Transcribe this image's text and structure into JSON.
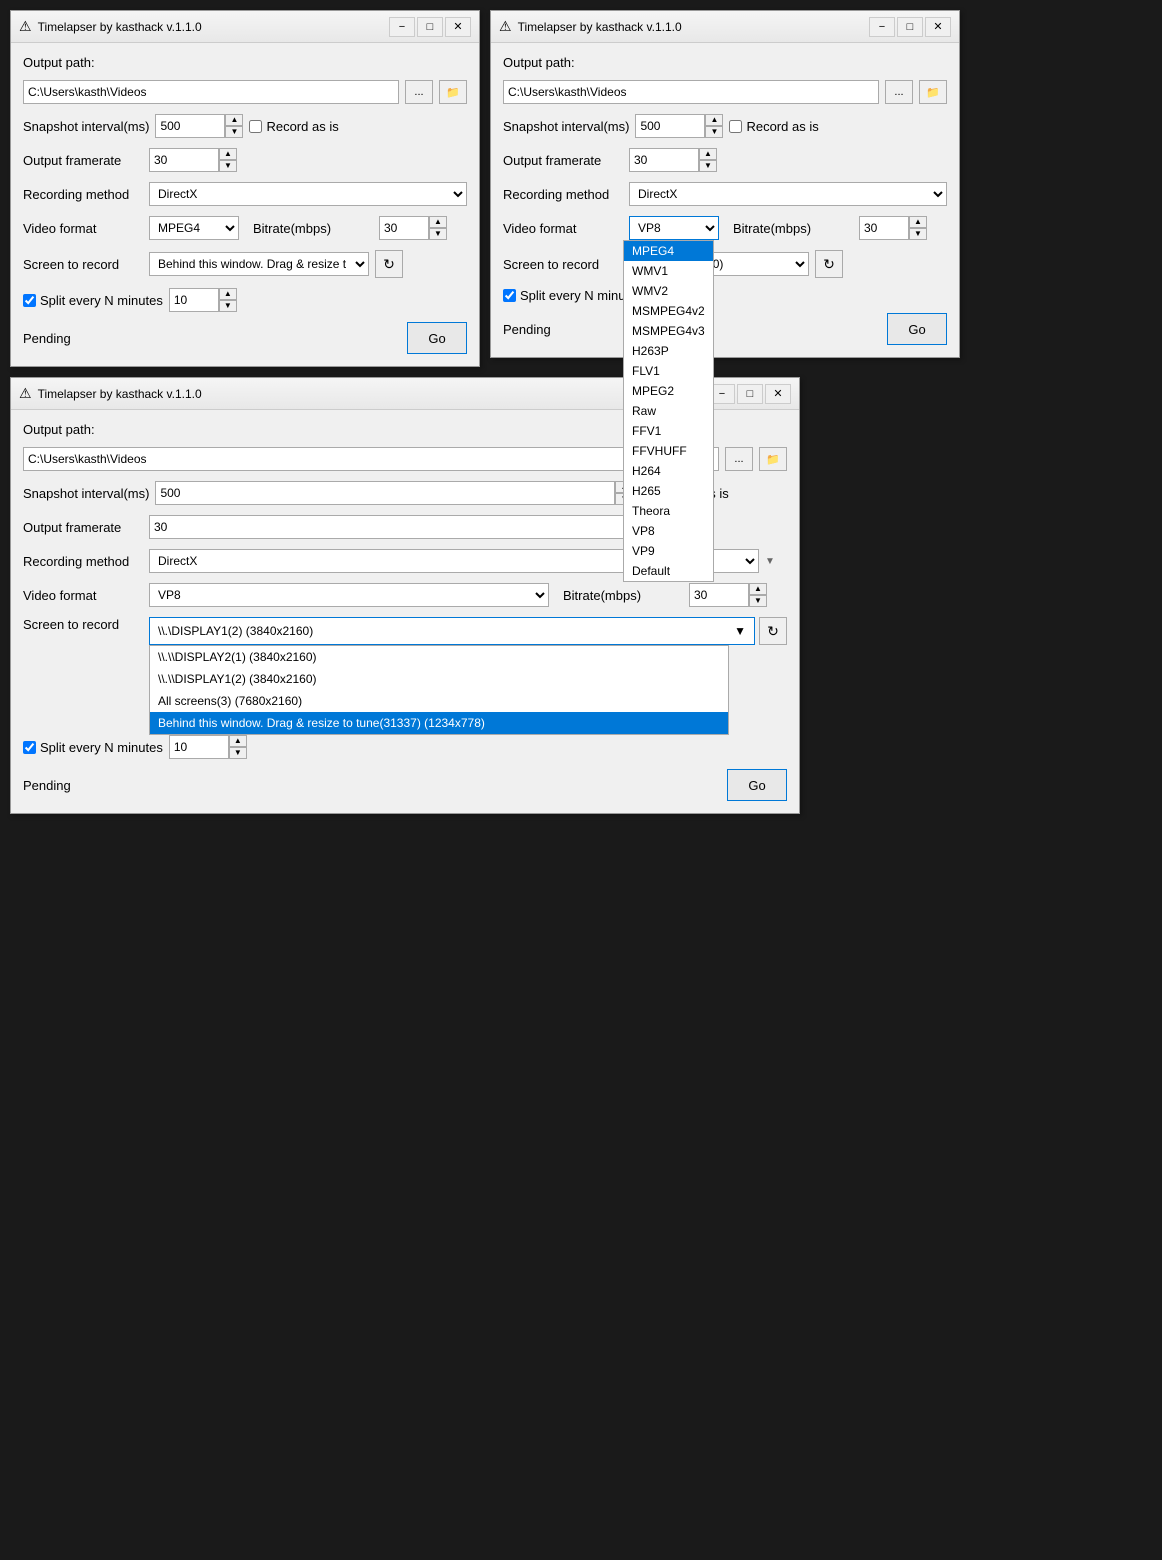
{
  "window1": {
    "title": "Timelapser by kasthack v.1.1.0",
    "output_path_label": "Output path:",
    "output_path_value": "C:\\Users\\kasth\\Videos",
    "snapshot_interval_label": "Snapshot interval(ms)",
    "snapshot_interval_value": "500",
    "record_as_is_label": "Record as is",
    "output_framerate_label": "Output framerate",
    "output_framerate_value": "30",
    "recording_method_label": "Recording method",
    "recording_method_value": "DirectX",
    "video_format_label": "Video format",
    "video_format_value": "MPEG4",
    "bitrate_label": "Bitrate(mbps)",
    "bitrate_value": "30",
    "screen_to_record_label": "Screen to record",
    "screen_to_record_value": "Behind this window. Drag & resize t",
    "split_label": "Split every N minutes",
    "split_value": "10",
    "status_label": "Pending",
    "go_btn_label": "Go",
    "browse_dots": "...",
    "browse_folder": "📁"
  },
  "window2": {
    "title": "Timelapser by kasthack v.1.1.0",
    "output_path_label": "Output path:",
    "output_path_value": "C:\\Users\\kasth\\Videos",
    "snapshot_interval_label": "Snapshot interval(ms)",
    "snapshot_interval_value": "500",
    "record_as_is_label": "Record as is",
    "output_framerate_label": "Output framerate",
    "output_framerate_value": "30",
    "recording_method_label": "Recording method",
    "recording_method_value": "DirectX",
    "video_format_label": "Video format",
    "video_format_value": "VP8",
    "bitrate_label": "Bitrate(mbps)",
    "bitrate_value": "30",
    "screen_to_record_label": "Screen to record",
    "screen_to_record_value": "(2) (3840x2160)",
    "split_label": "Split every N minutes",
    "status_label": "Pending",
    "go_btn_label": "Go",
    "browse_dots": "...",
    "browse_folder": "📁",
    "dropdown_items": [
      {
        "label": "MPEG4",
        "selected": true
      },
      {
        "label": "WMV1",
        "selected": false
      },
      {
        "label": "WMV2",
        "selected": false
      },
      {
        "label": "MSMPEG4v2",
        "selected": false
      },
      {
        "label": "MSMPEG4v3",
        "selected": false
      },
      {
        "label": "H263P",
        "selected": false
      },
      {
        "label": "FLV1",
        "selected": false
      },
      {
        "label": "MPEG2",
        "selected": false
      },
      {
        "label": "Raw",
        "selected": false
      },
      {
        "label": "FFV1",
        "selected": false
      },
      {
        "label": "FFVHUFF",
        "selected": false
      },
      {
        "label": "H264",
        "selected": false
      },
      {
        "label": "H265",
        "selected": false
      },
      {
        "label": "Theora",
        "selected": false
      },
      {
        "label": "VP8",
        "selected": false
      },
      {
        "label": "VP9",
        "selected": false
      },
      {
        "label": "Default",
        "selected": false
      }
    ]
  },
  "window3": {
    "title": "Timelapser by kasthack v.1.1.0",
    "output_path_label": "Output path:",
    "output_path_value": "C:\\Users\\kasth\\Videos",
    "snapshot_interval_label": "Snapshot interval(ms)",
    "snapshot_interval_value": "500",
    "record_as_is_label": "Record as is",
    "output_framerate_label": "Output framerate",
    "output_framerate_value": "30",
    "recording_method_label": "Recording method",
    "recording_method_value": "DirectX",
    "video_format_label": "Video format",
    "video_format_value": "VP8",
    "bitrate_label": "Bitrate(mbps)",
    "bitrate_value": "30",
    "screen_to_record_label": "Screen to record",
    "screen_to_record_value": "\\\\.\\DISPLAY1(2) (3840x2160)",
    "split_label": "Split every N minutes",
    "split_value": "10",
    "status_label": "Pending",
    "go_btn_label": "Go",
    "browse_dots": "...",
    "browse_folder": "📁",
    "screen_dropdown_items": [
      {
        "label": "\\\\.\\DISPLAY2(1) (3840x2160)",
        "selected": false
      },
      {
        "label": "\\\\.\\DISPLAY1(2) (3840x2160)",
        "selected": false
      },
      {
        "label": "All screens(3) (7680x2160)",
        "selected": false
      },
      {
        "label": "Behind this window. Drag & resize to tune(31337) (1234x778)",
        "selected": true
      }
    ]
  },
  "icons": {
    "warning": "⚠",
    "folder": "📁",
    "minimize": "−",
    "maximize": "□",
    "close": "✕",
    "spinner_up": "▲",
    "spinner_down": "▼",
    "refresh": "↻",
    "chevron_down": "▼"
  }
}
